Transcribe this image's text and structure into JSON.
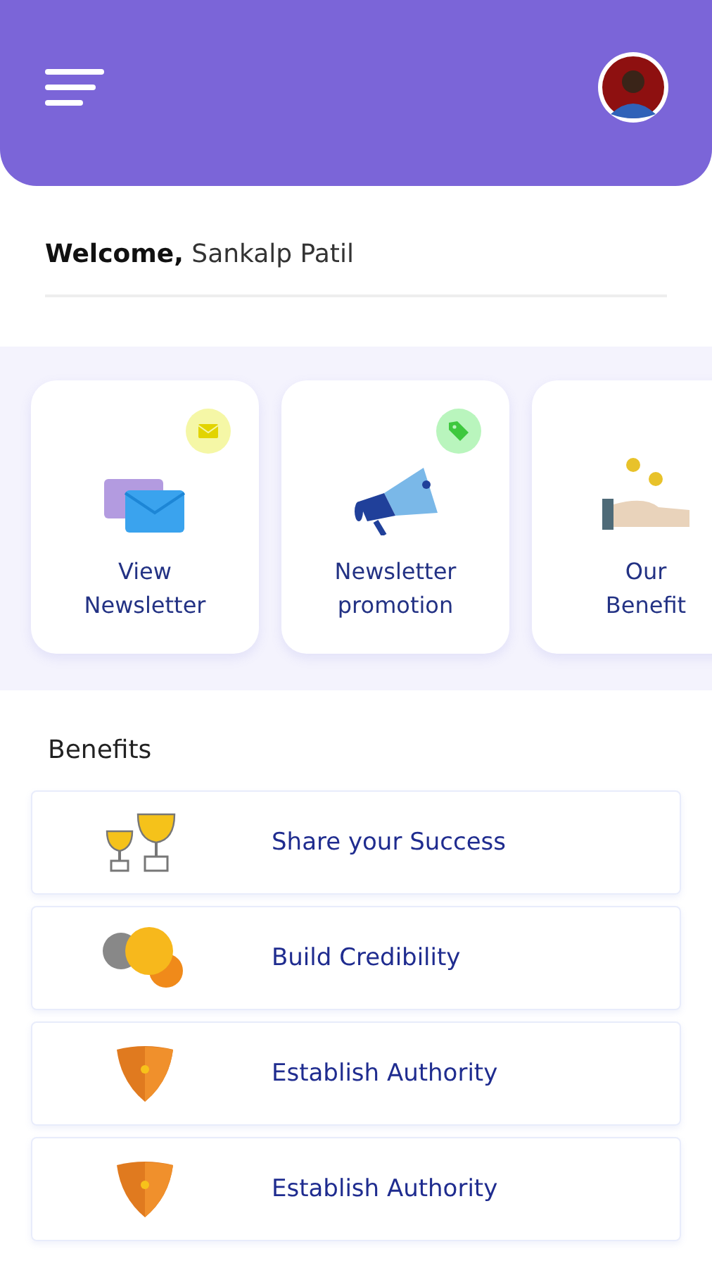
{
  "welcome": {
    "greeting": "Welcome,",
    "name": "Sankalp Patil"
  },
  "shortcuts": [
    {
      "kind": "newsletter",
      "title": "View Newsletter"
    },
    {
      "kind": "promotion",
      "title": "Newsletter promotion"
    },
    {
      "kind": "benefits",
      "title": "Our Benefit"
    }
  ],
  "benefits": {
    "heading": "Benefits",
    "items": [
      {
        "kind": "trophy",
        "label": "Share your Success"
      },
      {
        "kind": "coins",
        "label": "Build Credibility"
      },
      {
        "kind": "shield",
        "label": "Establish Authority"
      },
      {
        "kind": "shield",
        "label": "Establish Authority"
      }
    ]
  }
}
